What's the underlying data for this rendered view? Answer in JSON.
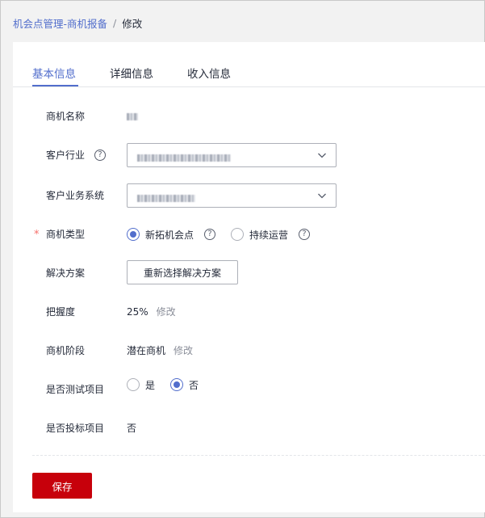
{
  "breadcrumb": {
    "parent": "机会点管理-商机报备",
    "separator": "/",
    "current": "修改"
  },
  "tabs": [
    {
      "label": "基本信息",
      "active": true
    },
    {
      "label": "详细信息",
      "active": false
    },
    {
      "label": "收入信息",
      "active": false
    }
  ],
  "form": {
    "opportunity_name": {
      "label": "商机名称"
    },
    "industry": {
      "label": "客户行业",
      "help": "?"
    },
    "business_system": {
      "label": "客户业务系统"
    },
    "opportunity_type": {
      "label": "商机类型",
      "required_mark": "*",
      "options": [
        {
          "label": "新拓机会点",
          "selected": true,
          "help": "?"
        },
        {
          "label": "持续运营",
          "selected": false,
          "help": "?"
        }
      ]
    },
    "solution": {
      "label": "解决方案",
      "button": "重新选择解决方案"
    },
    "confidence": {
      "label": "把握度",
      "value": "25%",
      "edit": "修改"
    },
    "stage": {
      "label": "商机阶段",
      "value": "潜在商机",
      "edit": "修改"
    },
    "is_test": {
      "label": "是否测试项目",
      "options": [
        {
          "label": "是",
          "selected": false
        },
        {
          "label": "否",
          "selected": true
        }
      ]
    },
    "is_bid": {
      "label": "是否投标项目",
      "value": "否"
    }
  },
  "actions": {
    "save": "保存"
  },
  "colors": {
    "accent": "#526ecc",
    "primary_button": "#c7000b",
    "required": "#f66f6a"
  }
}
